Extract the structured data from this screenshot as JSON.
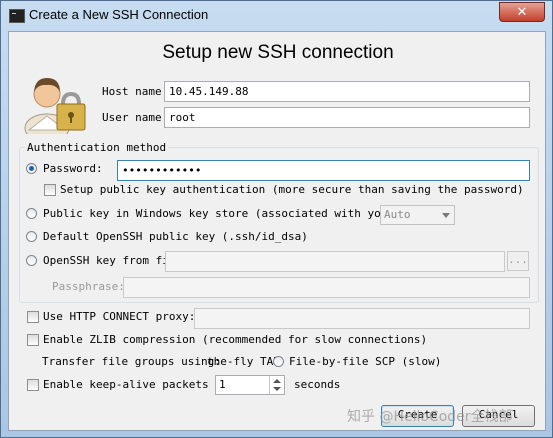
{
  "window": {
    "title": "Create a New SSH Connection",
    "close_glyph": "✕"
  },
  "heading": "Setup new SSH connection",
  "host": {
    "label": "Host name:",
    "value": "10.45.149.88"
  },
  "user": {
    "label": "User name:",
    "value": "root"
  },
  "auth": {
    "legend": "Authentication method",
    "password_label": "Password:",
    "password_value": "••••••••••••",
    "setup_pubkey_label": "Setup public key authentication (more secure than saving the password)",
    "windows_keystore_label": "Public key in Windows key store (associated with your us",
    "keystore_select": "Auto",
    "default_openssh_label": "Default OpenSSH public key (.ssh/id_dsa)",
    "openssh_file_label": "OpenSSH key from file:",
    "browse_label": "...",
    "passphrase_label": "Passphrase:"
  },
  "options": {
    "http_proxy_label": "Use HTTP CONNECT proxy:",
    "zlib_label": "Enable ZLIB compression (recommended for slow connections)",
    "transfer_label": "Transfer file groups using:",
    "transfer_fly": "the-fly TAR",
    "transfer_scp": "File-by-file SCP (slow)",
    "keepalive_label": "Enable keep-alive packets eve",
    "keepalive_value": "1",
    "seconds_label": "seconds"
  },
  "buttons": {
    "create": "Create",
    "cancel": "Cancel"
  },
  "watermark": "知乎 @HelloCoder全栈部"
}
